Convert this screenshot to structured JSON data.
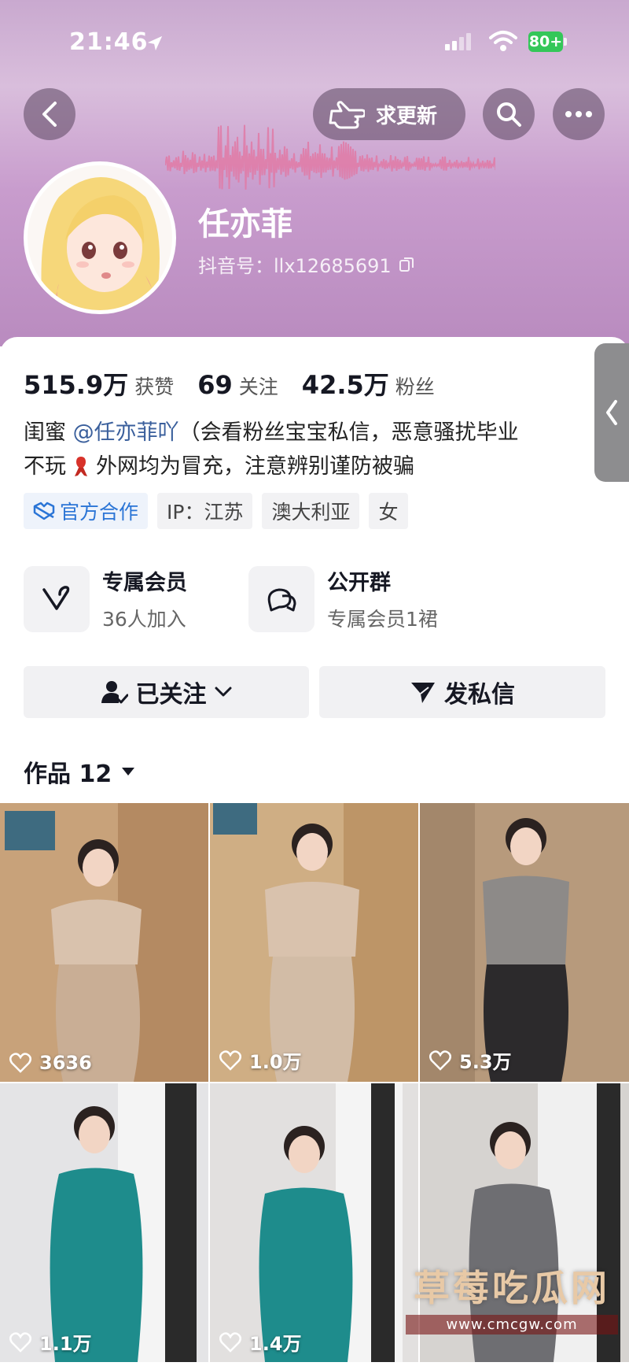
{
  "status_bar": {
    "time": "21:46",
    "battery": "80+"
  },
  "header": {
    "update_label": "求更新"
  },
  "profile": {
    "name": "任亦菲",
    "douyin_id": "抖音号：llx12685691"
  },
  "stats": [
    {
      "value": "515.9万",
      "label": "获赞"
    },
    {
      "value": "69",
      "label": "关注"
    },
    {
      "value": "42.5万",
      "label": "粉丝"
    }
  ],
  "bio": {
    "prefix": "闺蜜 ",
    "mention": "@任亦菲吖",
    "line1_rest": "（会看粉丝宝宝私信，恶意骚扰毕业",
    "line2_a": "不玩",
    "line2_b": "外网均为冒充，注意辨别谨防被骗"
  },
  "tags": {
    "official": "官方合作",
    "ip": "IP：江苏",
    "location": "澳大利亚",
    "gender": "女"
  },
  "features": [
    {
      "title": "专属会员",
      "sub": "36人加入"
    },
    {
      "title": "公开群",
      "sub": "专属会员1裙"
    }
  ],
  "actions": {
    "follow": "已关注",
    "message": "发私信"
  },
  "works": {
    "label": "作品 12"
  },
  "videos": [
    {
      "likes": "3636"
    },
    {
      "likes": "1.0万"
    },
    {
      "likes": "5.3万"
    },
    {
      "likes": "1.1万"
    },
    {
      "likes": "1.4万"
    },
    {
      "likes": ""
    }
  ],
  "watermark": {
    "title": "草莓吃瓜网",
    "url": "www.cmcgw.com"
  },
  "colors": {
    "header_top": "#c9a9cf",
    "header_bottom": "#b98bbf",
    "official_blue": "#2b75d6",
    "mention_blue": "#3a5f9c"
  }
}
